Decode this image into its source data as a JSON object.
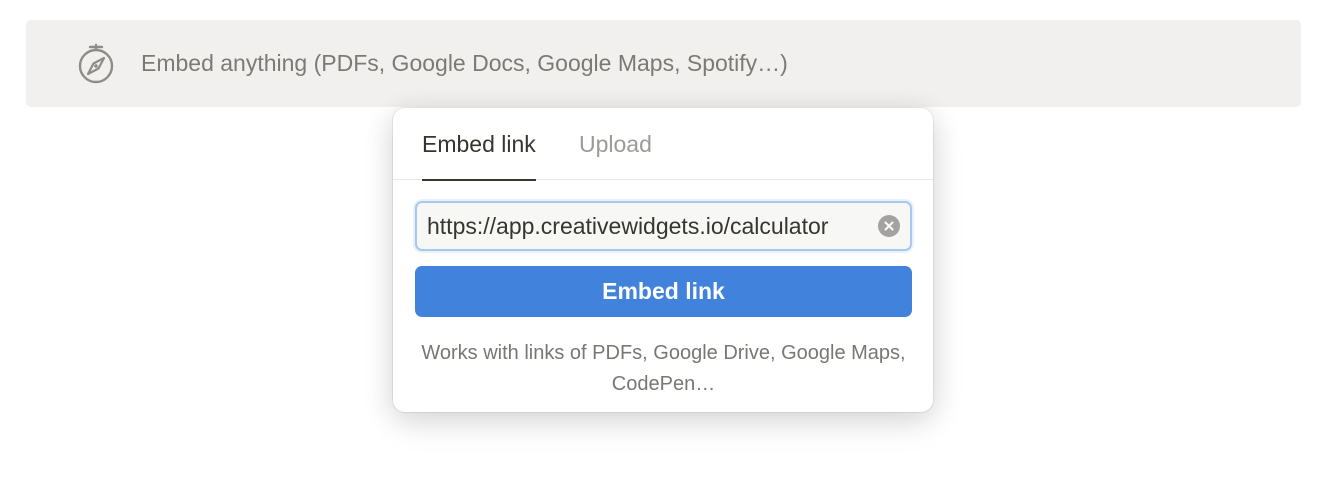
{
  "embed_block": {
    "icon": "compass-icon",
    "placeholder": "Embed anything (PDFs, Google Docs, Google Maps, Spotify…)"
  },
  "popover": {
    "tabs": [
      {
        "label": "Embed link",
        "active": true
      },
      {
        "label": "Upload",
        "active": false
      }
    ],
    "url_input": {
      "value": "https://app.creativewidgets.io/calculator"
    },
    "clear_icon": "clear-circle-icon",
    "embed_button_label": "Embed link",
    "helper_text": "Works with links of PDFs, Google Drive, Google Maps, CodePen…"
  },
  "colors": {
    "accent": "#4182dc",
    "block_bg": "#f1f0ef",
    "text_primary": "#37352f",
    "text_muted": "#7d7a75"
  }
}
